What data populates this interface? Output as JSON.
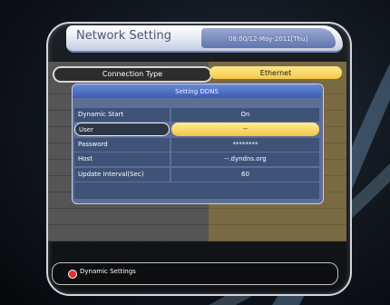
{
  "header": {
    "title": "Network Setting",
    "clock": "08:00/12-May-2011[Thu]"
  },
  "connection": {
    "label": "Connection Type",
    "value": "Ethernet"
  },
  "dialog": {
    "title": "Setting DDNS",
    "rows": [
      {
        "label": "Dynamic Start",
        "value": "On"
      },
      {
        "label": "User",
        "value": "--"
      },
      {
        "label": "Password",
        "value": "********"
      },
      {
        "label": "Host",
        "value": "--.dyndns.org"
      },
      {
        "label": "Update Interval(Sec)",
        "value": "60"
      }
    ]
  },
  "footer": {
    "hint": "Dynamic Settings",
    "hint_icon": "red-button-icon"
  }
}
